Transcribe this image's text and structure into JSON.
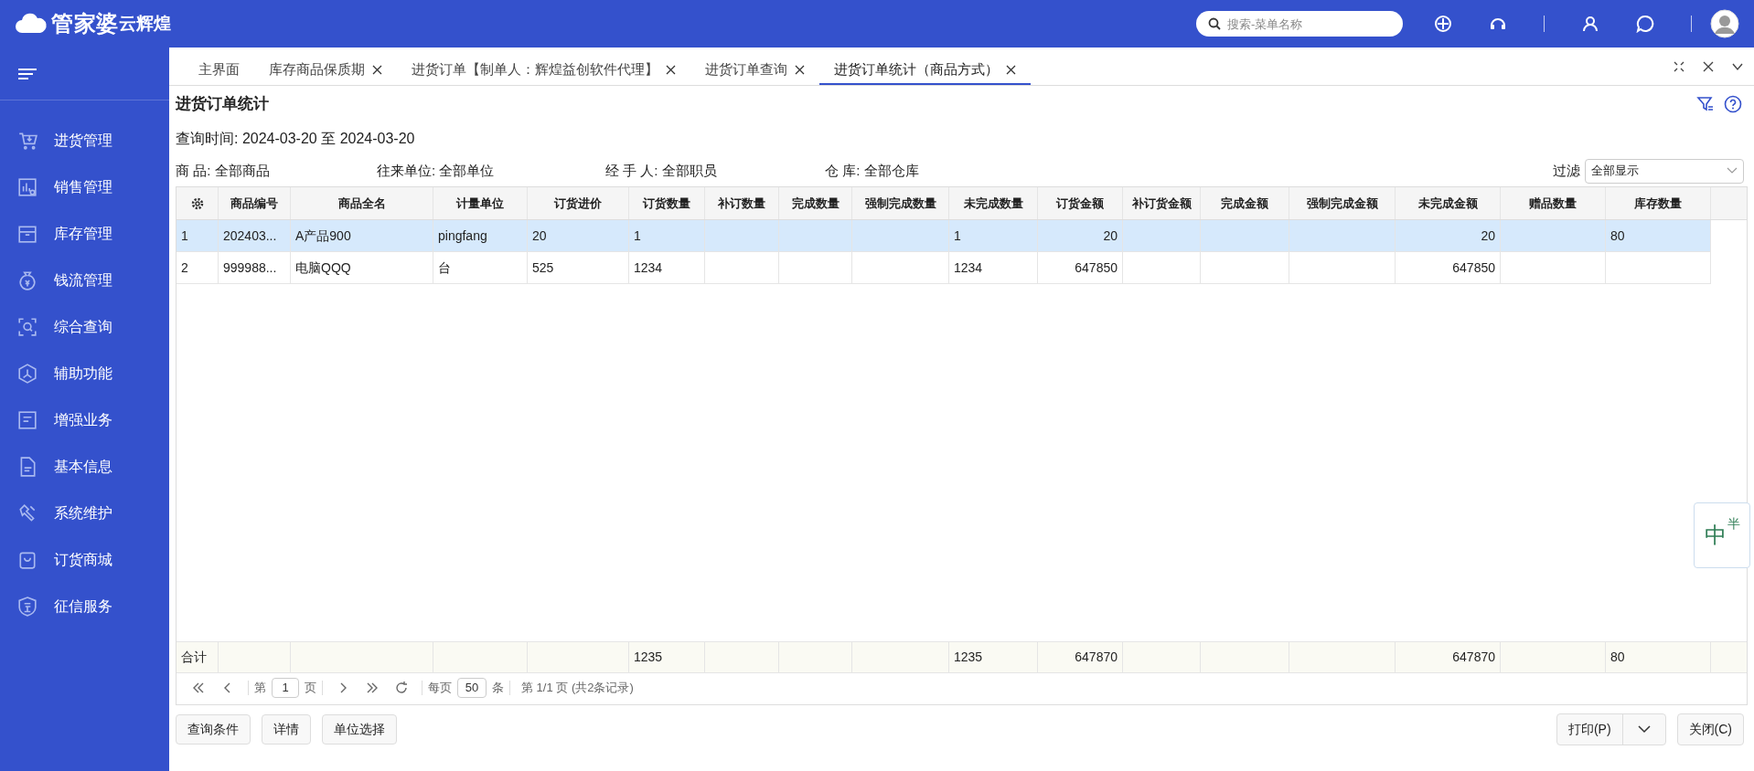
{
  "header": {
    "logo": "管家婆",
    "logo_sub": "云辉煌",
    "search_placeholder": "搜索-菜单名称"
  },
  "sidebar": {
    "items": [
      {
        "label": "进货管理"
      },
      {
        "label": "销售管理"
      },
      {
        "label": "库存管理"
      },
      {
        "label": "钱流管理"
      },
      {
        "label": "综合查询"
      },
      {
        "label": "辅助功能"
      },
      {
        "label": "增强业务"
      },
      {
        "label": "基本信息"
      },
      {
        "label": "系统维护"
      },
      {
        "label": "订货商城"
      },
      {
        "label": "征信服务"
      }
    ]
  },
  "tabs": [
    {
      "label": "主界面",
      "closable": false,
      "selected": false
    },
    {
      "label": "库存商品保质期",
      "closable": true,
      "selected": false
    },
    {
      "label": "进货订单【制单人：辉煌益创软件代理】",
      "closable": true,
      "selected": false
    },
    {
      "label": "进货订单查询",
      "closable": true,
      "selected": false
    },
    {
      "label": "进货订单统计（商品方式）",
      "closable": true,
      "selected": true
    }
  ],
  "page": {
    "title": "进货订单统计",
    "query_time": "查询时间: 2024-03-20 至 2024-03-20",
    "filters": [
      {
        "label": "商 品:",
        "value": "全部商品"
      },
      {
        "label": "往来单位:",
        "value": "全部单位"
      },
      {
        "label": "经 手 人:",
        "value": "全部职员"
      },
      {
        "label": "仓 库:",
        "value": "全部仓库"
      }
    ],
    "filter_label": "过滤",
    "filter_value": "全部显示"
  },
  "table": {
    "columns": [
      null,
      "商品编号",
      "商品全名",
      "计量单位",
      "订货进价",
      "订货数量",
      "补订数量",
      "完成数量",
      "强制完成数量",
      "未完成数量",
      "订货金额",
      "补订货金额",
      "完成金额",
      "强制完成金额",
      "未完成金额",
      "赠品数量",
      "库存数量"
    ],
    "rows": [
      {
        "kind": "data",
        "selected": true,
        "cells": [
          "1",
          "202403...",
          "A产品900",
          "pingfang",
          "20",
          "1",
          null,
          null,
          null,
          "1",
          "20",
          null,
          null,
          null,
          "20",
          null,
          "80"
        ]
      },
      {
        "kind": "data",
        "selected": false,
        "cells": [
          "2",
          "999988...",
          "电脑QQQ",
          "台",
          "525",
          "1234",
          null,
          null,
          null,
          "1234",
          "647850",
          null,
          null,
          null,
          "647850",
          null,
          null
        ]
      },
      {
        "kind": "total",
        "selected": false,
        "cells": [
          "合计",
          null,
          null,
          null,
          null,
          "1235",
          null,
          null,
          null,
          "1235",
          "647870",
          null,
          null,
          null,
          "647870",
          null,
          "80"
        ]
      }
    ]
  },
  "pager": {
    "page_prefix": "第",
    "page": "1",
    "page_suffix": "页",
    "per_page_prefix": "每页",
    "per_page": "50",
    "per_page_suffix": "条",
    "summary": "第 1/1 页 (共2条记录)"
  },
  "buttons_left": [
    "查询条件",
    "详情",
    "单位选择"
  ],
  "print_button": "打印(P)",
  "close_button": "关闭(C)",
  "ime_widget": {
    "chars": [
      "中",
      "半"
    ]
  }
}
